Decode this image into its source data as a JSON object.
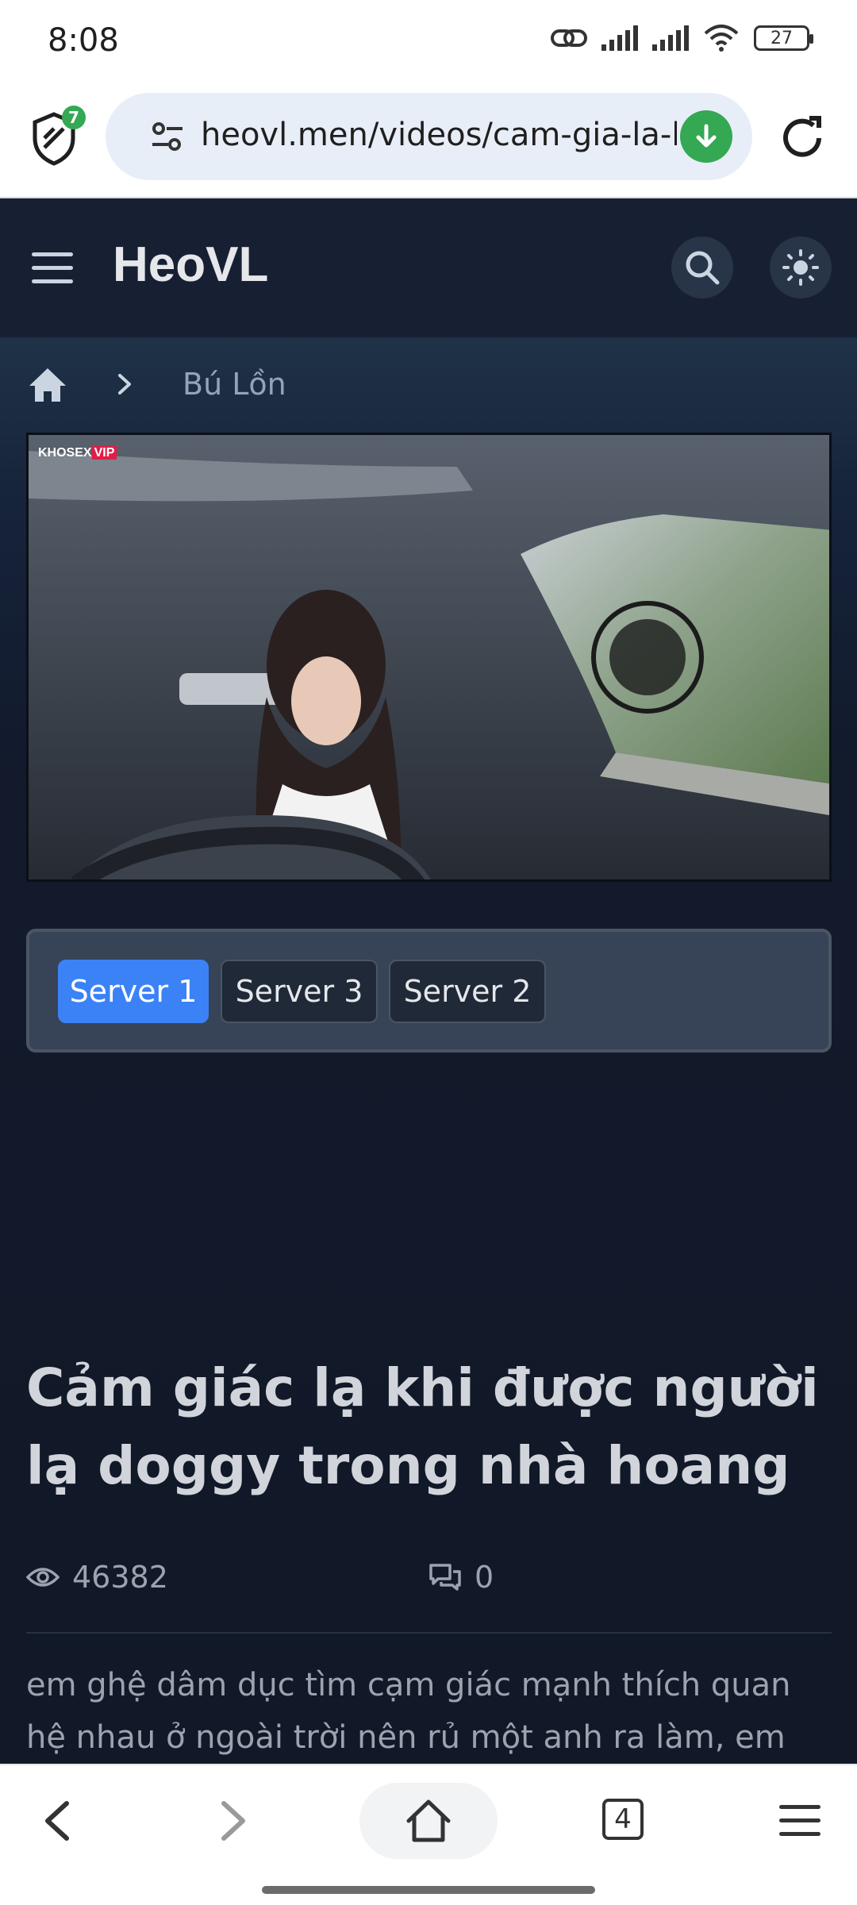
{
  "status_bar": {
    "time": "8:08",
    "battery": "27"
  },
  "browser": {
    "url": "heovl.men/videos/cam-gia-la-kl",
    "shield_badge": "7",
    "tabs_count": "4"
  },
  "site": {
    "title": "HeoVL"
  },
  "breadcrumb": {
    "category": "Bú Lồn"
  },
  "video": {
    "watermark_brand": "KHOSEX",
    "watermark_suffix": "VIP"
  },
  "servers": [
    {
      "label": "Server 1",
      "active": true
    },
    {
      "label": "Server 3",
      "active": false
    },
    {
      "label": "Server 2",
      "active": false
    }
  ],
  "page": {
    "title": "Cảm giác lạ khi được người lạ doggy trong nhà hoang",
    "views": "46382",
    "comments": "0",
    "description": "em ghệ dâm dục tìm cạm giác mạnh thích quan hệ nhau ở ngoài trời nên rủ một anh ra làm, em"
  },
  "colors": {
    "accent": "#3b82f6",
    "header_bg": "#172033",
    "page_bg": "#111827"
  }
}
